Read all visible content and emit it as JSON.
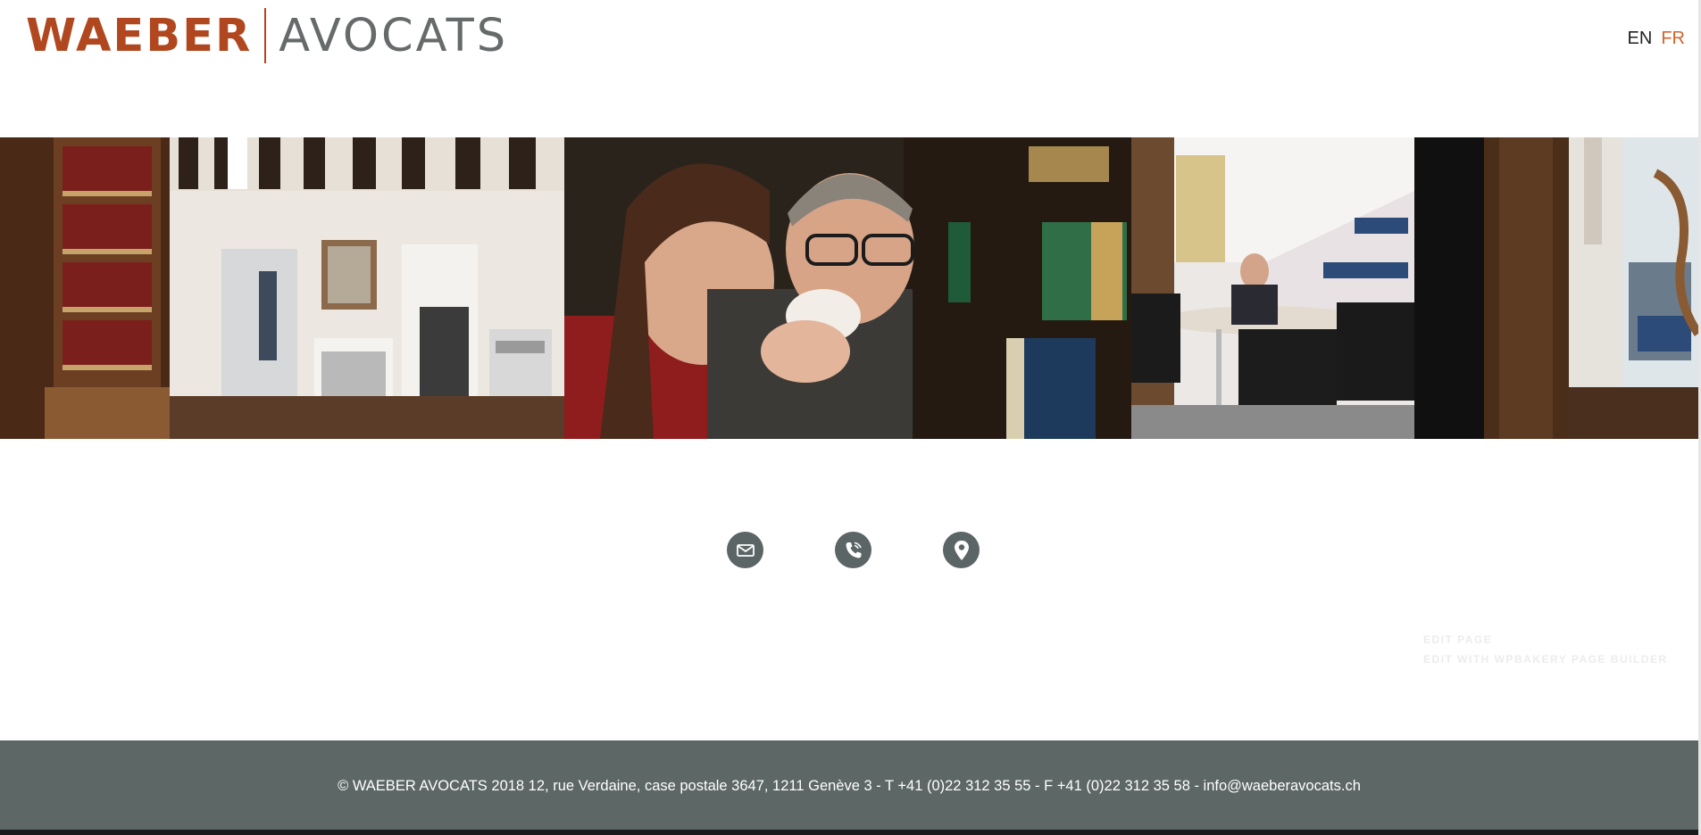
{
  "header": {
    "logo": {
      "left": "WAEBER",
      "right": "AVOCATS"
    },
    "languages": [
      "EN",
      "FR"
    ]
  },
  "colors": {
    "brand": "#b0471f",
    "active_lang": "#d4622a",
    "footer_bg": "#5d6766",
    "icon_bg": "#5b6566"
  },
  "contact_icons": [
    "envelope-icon",
    "phone-icon",
    "map-pin-icon"
  ],
  "edit_links": [
    "EDIT PAGE",
    "EDIT WITH WPBAKERY PAGE BUILDER"
  ],
  "footer": {
    "text": "© WAEBER AVOCATS 2018 12, rue Verdaine, case postale 3647, 1211 Genève 3 - T +41 (0)22 312 35 55 - F +41 (0)22 312 35 58 - info@waeberavocats.ch"
  }
}
